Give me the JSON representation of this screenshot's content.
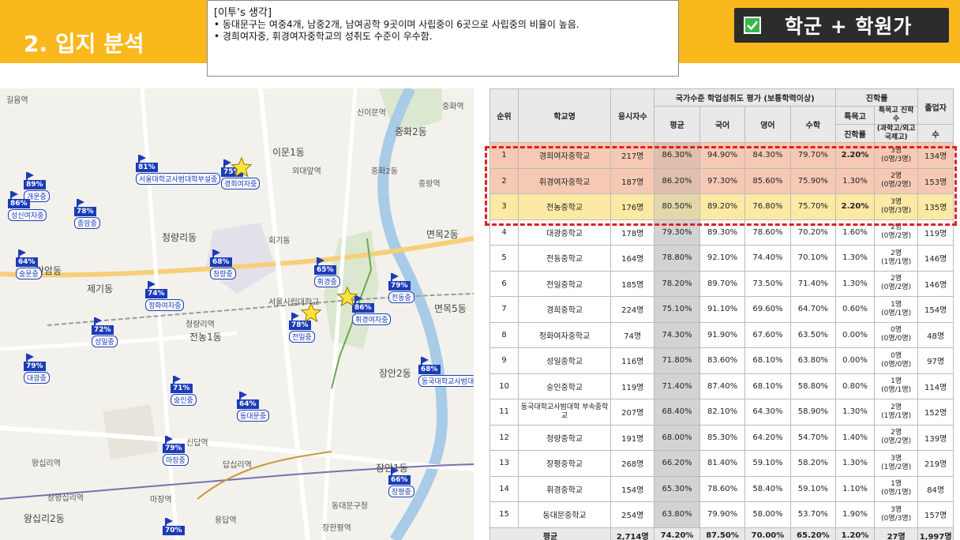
{
  "header": {
    "section_title": "2. 입지 분석",
    "note_title": "[이투’s 생각]",
    "note_lines": [
      "• 동대문구는 여중4개, 남중2개, 남여공학 9곳이며 사립중이 6곳으로 사립중의 비율이 높음.",
      "• 경희여자중, 휘경여자중학교의 성취도 수준이 우수함."
    ],
    "badge_text": "학군 + 학원가",
    "check_icon": "check-icon",
    "band_color": "#f9b81b"
  },
  "map": {
    "labels": [
      {
        "text": "길음역"
      },
      {
        "text": "신이문역"
      },
      {
        "text": "중화역"
      },
      {
        "text": "중화2동"
      },
      {
        "text": "이문1동"
      },
      {
        "text": "외대앞역"
      },
      {
        "text": "중화2동"
      },
      {
        "text": "중랑역"
      },
      {
        "text": "안암동"
      },
      {
        "text": "회기동"
      },
      {
        "text": "청량리동"
      },
      {
        "text": "면목2동"
      },
      {
        "text": "제기동"
      },
      {
        "text": "전농1동"
      },
      {
        "text": "답십리역"
      },
      {
        "text": "장안2동"
      },
      {
        "text": "장안1동"
      },
      {
        "text": "왕십리역"
      },
      {
        "text": "왕십리2동"
      },
      {
        "text": "용답역"
      },
      {
        "text": "장한평역"
      },
      {
        "text": "면목5동"
      },
      {
        "text": "신답역"
      },
      {
        "text": "마장역"
      },
      {
        "text": "상왕십리역"
      },
      {
        "text": "서울시립대학교"
      },
      {
        "text": "청량리역"
      },
      {
        "text": "동대문구청"
      }
    ],
    "schools": [
      {
        "pct": "81%",
        "name": "서울대학교사범대학부설중"
      },
      {
        "pct": "89%",
        "name": "개운중"
      },
      {
        "pct": "86%",
        "name": "성신여자중"
      },
      {
        "pct": "78%",
        "name": "종암중"
      },
      {
        "pct": "75%",
        "name": "경희여자중"
      },
      {
        "pct": "64%",
        "name": "숭문중"
      },
      {
        "pct": "68%",
        "name": "청량중"
      },
      {
        "pct": "65%",
        "name": "휘경중"
      },
      {
        "pct": "79%",
        "name": "전동중"
      },
      {
        "pct": "74%",
        "name": "정화여자중"
      },
      {
        "pct": "86%",
        "name": "휘경여자중"
      },
      {
        "pct": "78%",
        "name": "전일중"
      },
      {
        "pct": "72%",
        "name": "성일중"
      },
      {
        "pct": "79%",
        "name": "대광중"
      },
      {
        "pct": "68%",
        "name": "동국대학교사범대"
      },
      {
        "pct": "71%",
        "name": "숭인중"
      },
      {
        "pct": "64%",
        "name": "동대문중"
      },
      {
        "pct": "79%",
        "name": "마장중"
      },
      {
        "pct": "66%",
        "name": "장평중"
      },
      {
        "pct": "70%",
        "name": ""
      }
    ]
  },
  "table": {
    "headers": {
      "rank": "순위",
      "school": "학교명",
      "applicants": "응시자수",
      "national_group": "국가수준 학업성취도 평가 (보통학력이상)",
      "avg": "평균",
      "korean": "국어",
      "english": "영어",
      "math": "수학",
      "advance_group": "진학률",
      "special": "특목고",
      "special_rate": "진학률",
      "special_count": "특목고 진학수",
      "special_sub": "(과학고/외고국제고)",
      "graduates": "졸업자",
      "graduates_sub": "수"
    },
    "rows": [
      {
        "rank": "1",
        "school": "경희여자중학교",
        "applicants": "217명",
        "avg": "86.30%",
        "korean": "94.90%",
        "english": "84.30%",
        "math": "79.70%",
        "rate": "2.20%",
        "count": "3명",
        "detail": "(0명/3명)",
        "grads": "134명"
      },
      {
        "rank": "2",
        "school": "휘경여자중학교",
        "applicants": "187명",
        "avg": "86.20%",
        "korean": "97.30%",
        "english": "85.60%",
        "math": "75.90%",
        "rate": "1.30%",
        "count": "2명",
        "detail": "(0명/2명)",
        "grads": "153명"
      },
      {
        "rank": "3",
        "school": "전농중학교",
        "applicants": "176명",
        "avg": "80.50%",
        "korean": "89.20%",
        "english": "76.80%",
        "math": "75.70%",
        "rate": "2.20%",
        "count": "3명",
        "detail": "(0명/3명)",
        "grads": "135명"
      },
      {
        "rank": "4",
        "school": "대광중학교",
        "applicants": "178명",
        "avg": "79.30%",
        "korean": "89.30%",
        "english": "78.60%",
        "math": "70.20%",
        "rate": "1.60%",
        "count": "2명",
        "detail": "(0명/2명)",
        "grads": "119명"
      },
      {
        "rank": "5",
        "school": "전동중학교",
        "applicants": "164명",
        "avg": "78.80%",
        "korean": "92.10%",
        "english": "74.40%",
        "math": "70.10%",
        "rate": "1.30%",
        "count": "2명",
        "detail": "(1명/1명)",
        "grads": "146명"
      },
      {
        "rank": "6",
        "school": "전일중학교",
        "applicants": "185명",
        "avg": "78.20%",
        "korean": "89.70%",
        "english": "73.50%",
        "math": "71.40%",
        "rate": "1.30%",
        "count": "2명",
        "detail": "(0명/2명)",
        "grads": "146명"
      },
      {
        "rank": "7",
        "school": "경희중학교",
        "applicants": "224명",
        "avg": "75.10%",
        "korean": "91.10%",
        "english": "69.60%",
        "math": "64.70%",
        "rate": "0.60%",
        "count": "1명",
        "detail": "(0명/1명)",
        "grads": "154명"
      },
      {
        "rank": "8",
        "school": "정화여자중학교",
        "applicants": "74명",
        "avg": "74.30%",
        "korean": "91.90%",
        "english": "67.60%",
        "math": "63.50%",
        "rate": "0.00%",
        "count": "0명",
        "detail": "(0명/0명)",
        "grads": "48명"
      },
      {
        "rank": "9",
        "school": "성일중학교",
        "applicants": "116명",
        "avg": "71.80%",
        "korean": "83.60%",
        "english": "68.10%",
        "math": "63.80%",
        "rate": "0.00%",
        "count": "0명",
        "detail": "(0명/0명)",
        "grads": "97명"
      },
      {
        "rank": "10",
        "school": "숭인중학교",
        "applicants": "119명",
        "avg": "71.40%",
        "korean": "87.40%",
        "english": "68.10%",
        "math": "58.80%",
        "rate": "0.80%",
        "count": "1명",
        "detail": "(0명/1명)",
        "grads": "114명"
      },
      {
        "rank": "11",
        "school": "동국대학교사범대학 부속중학교",
        "applicants": "207명",
        "avg": "68.40%",
        "korean": "82.10%",
        "english": "64.30%",
        "math": "58.90%",
        "rate": "1.30%",
        "count": "2명",
        "detail": "(1명/1명)",
        "grads": "152명"
      },
      {
        "rank": "12",
        "school": "청량중학교",
        "applicants": "191명",
        "avg": "68.00%",
        "korean": "85.30%",
        "english": "64.20%",
        "math": "54.70%",
        "rate": "1.40%",
        "count": "2명",
        "detail": "(0명/2명)",
        "grads": "139명"
      },
      {
        "rank": "13",
        "school": "장평중학교",
        "applicants": "268명",
        "avg": "66.20%",
        "korean": "81.40%",
        "english": "59.10%",
        "math": "58.20%",
        "rate": "1.30%",
        "count": "3명",
        "detail": "(1명/2명)",
        "grads": "219명"
      },
      {
        "rank": "14",
        "school": "휘경중학교",
        "applicants": "154명",
        "avg": "65.30%",
        "korean": "78.60%",
        "english": "58.40%",
        "math": "59.10%",
        "rate": "1.10%",
        "count": "1명",
        "detail": "(0명/1명)",
        "grads": "84명"
      },
      {
        "rank": "15",
        "school": "동대문중학교",
        "applicants": "254명",
        "avg": "63.80%",
        "korean": "79.90%",
        "english": "58.00%",
        "math": "53.70%",
        "rate": "1.90%",
        "count": "3명",
        "detail": "(0명/3명)",
        "grads": "157명"
      }
    ],
    "footer": {
      "label": "평균",
      "applicants": "2,714명",
      "avg": "74.20%",
      "korean": "87.50%",
      "english": "70.00%",
      "math": "65.20%",
      "rate": "1.20%",
      "count": "27명",
      "grads": "1,997명"
    },
    "highlight_color": "#e02020"
  }
}
